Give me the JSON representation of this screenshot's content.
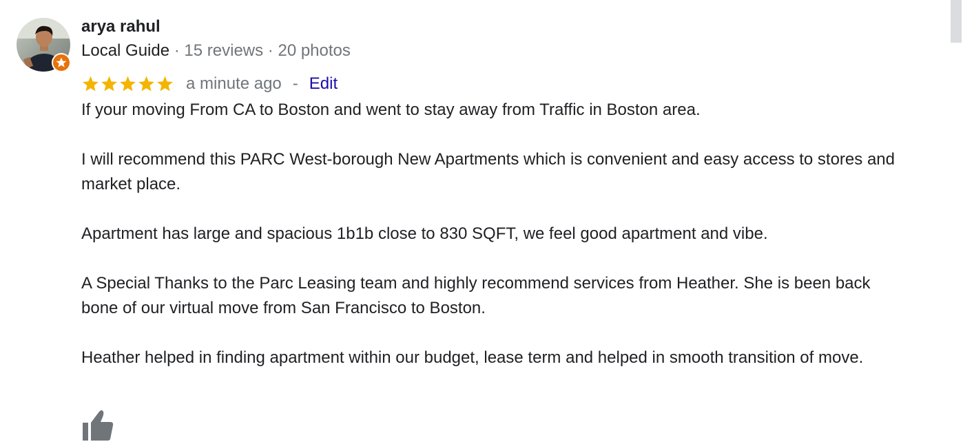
{
  "author": {
    "name": "arya rahul",
    "guide_label": "Local Guide",
    "reviews_count": "15 reviews",
    "photos_count": "20 photos",
    "separator": " · "
  },
  "review": {
    "rating": 5,
    "max_rating": 5,
    "time_ago": "a minute ago",
    "separator": "-",
    "edit_label": "Edit",
    "paragraphs": [
      "If your moving From CA to Boston and went to stay away from Traffic in Boston area.",
      "I will recommend this PARC West-borough New Apartments which is convenient and easy access to stores and market place.",
      "Apartment has large and spacious 1b1b close to 830 SQFT, we feel good apartment and vibe.",
      "A Special Thanks to the Parc Leasing team and highly recommend services from Heather. She is been back bone of our virtual move from San Francisco to Boston.",
      "Heather helped in finding apartment within our budget, lease term and helped in smooth transition of move."
    ]
  },
  "icons": {
    "avatar": "profile-photo",
    "guide_badge": "local-guide-star-badge-icon",
    "star": "star-icon",
    "like": "thumbs-up-icon"
  },
  "colors": {
    "star": "#f4b400",
    "link": "#1a0dab",
    "muted": "#70757a",
    "text": "#202124",
    "badge": "#e8710a",
    "like_icon": "#70757a"
  }
}
